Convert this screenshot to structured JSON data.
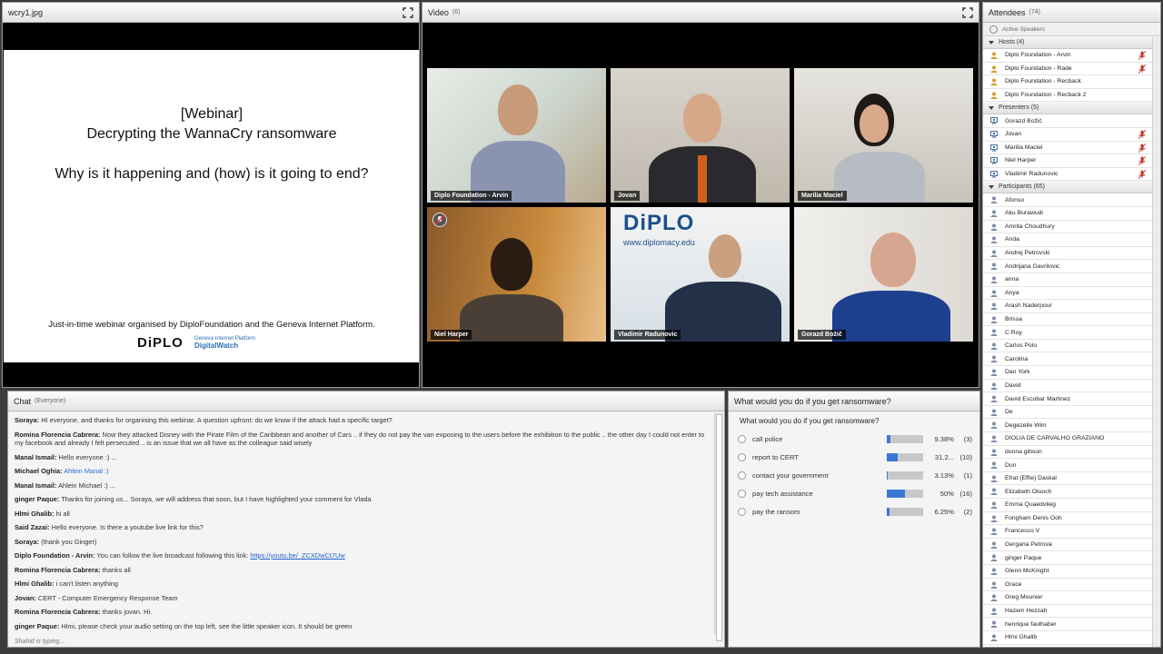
{
  "share": {
    "title": "wcry1.jpg",
    "slide": {
      "line1": "[Webinar]",
      "line2": "Decrypting the WannaCry ransomware",
      "line3": "Why is it happening and (how) is it going to end?",
      "footer": "Just-in-time webinar organised by DiploFoundation and the Geneva Internet Platform.",
      "logo": "DiPLO",
      "dw1": "Geneva Internet Platform",
      "dw2": "DigitalWatch"
    }
  },
  "video": {
    "title": "Video",
    "count": "(6)",
    "tiles": [
      {
        "name": "Diplo Foundation - Arvin"
      },
      {
        "name": "Jovan"
      },
      {
        "name": "Marilia Maciel"
      },
      {
        "name": "Niel Harper"
      },
      {
        "name": "Vladimir Radunovic",
        "banner": "DiPLO",
        "url": "www.diplomacy.edu"
      },
      {
        "name": "Gorazd Božič"
      }
    ]
  },
  "chat": {
    "title": "Chat",
    "scope": "(Everyone)",
    "messages": [
      {
        "sender": "Soraya:",
        "text": "HI everyone, and thanks for organising this webinar. A question upfront: do we know if the attack had a specific target?"
      },
      {
        "sender": "Romina Florencia Cabrera:",
        "text": "Now they attacked Disney with the Pirate Film of the Caribbean and another of Cars .. if they do not pay the van exposing to the users before the exhibition to the public .. the other day I could not enter to my facebook and already I felt persecuted .. is an issue that we all have as the colleague said wisely"
      },
      {
        "sender": "Manal Ismail:",
        "text": "Hello everyone :) ..."
      },
      {
        "sender": "Michael Oghia:",
        "text": "Ahlein Manal :)"
      },
      {
        "sender": "Manal Ismail:",
        "text": "Ahlein Michael :) ..."
      },
      {
        "sender": "ginger Paque:",
        "text": "Thanks for joining us... Soraya, we will address that soon, but I have highlighted your comment for Vlada"
      },
      {
        "sender": "Hlmi Ghalib:",
        "text": "hi all"
      },
      {
        "sender": "Said Zazai:",
        "text": "Hello everyone. Is there a youtube live link for this?"
      },
      {
        "sender": "Soraya:",
        "text": "(thank you Ginger)"
      },
      {
        "sender": "Diplo Foundation - Arvin:",
        "text": "You can follow the live broadcast following this link:",
        "link": "https://youtu.be/_ZCXDwCt7Uw"
      },
      {
        "sender": "Romina Florencia Cabrera:",
        "text": "thanks all"
      },
      {
        "sender": "Hlmi Ghalib:",
        "text": "i can't listen anything"
      },
      {
        "sender": "Jovan:",
        "text": "CERT - Computer Emergency Response Team"
      },
      {
        "sender": "Romina Florencia Cabrera:",
        "text": "thanks jovan. Hi."
      },
      {
        "sender": "ginger Paque:",
        "text": "Hlmi, please check your audio setting on the top left, see the little speaker icon. It should be green"
      }
    ],
    "typing": "Shahid is typing..."
  },
  "poll": {
    "title": "What would you do if you get ransomware?",
    "question": "What would you do if you get ransomware?",
    "options": [
      {
        "label": "call police",
        "pct": "9.38%",
        "count": "(3)",
        "fraction": 0.0938
      },
      {
        "label": "report to CERT",
        "pct": "31.2...",
        "count": "(10)",
        "fraction": 0.312
      },
      {
        "label": "contact your government",
        "pct": "3.13%",
        "count": "(1)",
        "fraction": 0.0313
      },
      {
        "label": "pay tech assistance",
        "pct": "50%",
        "count": "(16)",
        "fraction": 0.5
      },
      {
        "label": "pay the ransom",
        "pct": "6.25%",
        "count": "(2)",
        "fraction": 0.0625
      }
    ]
  },
  "attendees": {
    "title": "Attendees",
    "count": "(74)",
    "active_speakers": "Active Speakers",
    "groups": [
      {
        "label": "Hosts (4)",
        "role": "host",
        "members": [
          {
            "name": "Diplo Foundation - Arvin",
            "mic": true
          },
          {
            "name": "Diplo Foundation - Rade",
            "mic": true
          },
          {
            "name": "Diplo Foundation - Recback",
            "mic": false
          },
          {
            "name": "Diplo Foundation - Recback 2",
            "mic": false
          }
        ]
      },
      {
        "label": "Presenters (5)",
        "role": "presenter",
        "members": [
          {
            "name": "Gorazd Božič",
            "mic": false
          },
          {
            "name": "Jovan",
            "mic": true
          },
          {
            "name": "Marilia Maciel",
            "mic": true
          },
          {
            "name": "Niel Harper",
            "mic": true
          },
          {
            "name": "Vladimir Radunovic",
            "mic": true
          }
        ]
      },
      {
        "label": "Participants (65)",
        "role": "participant",
        "members": [
          {
            "name": "Afonso"
          },
          {
            "name": "Aku Burawudi"
          },
          {
            "name": "Amrita Choudhury"
          },
          {
            "name": "Anda"
          },
          {
            "name": "Andrej Petrovski"
          },
          {
            "name": "Andrijana Gavrilovic"
          },
          {
            "name": "anna"
          },
          {
            "name": "Anya"
          },
          {
            "name": "Arash Naderpour"
          },
          {
            "name": "Brissa"
          },
          {
            "name": "C Roy"
          },
          {
            "name": "Carlos Polo"
          },
          {
            "name": "Carolina"
          },
          {
            "name": "Dan York"
          },
          {
            "name": "David"
          },
          {
            "name": "David Escobar Martinez"
          },
          {
            "name": "De"
          },
          {
            "name": "Degezelle Wim"
          },
          {
            "name": "DIOLIA DE CARVALHO GRAZIANO"
          },
          {
            "name": "donna gibson"
          },
          {
            "name": "Dun"
          },
          {
            "name": "Efrat (Effie) Daskal"
          },
          {
            "name": "Elizabeth Oluoch"
          },
          {
            "name": "Emma Quaedvlieg"
          },
          {
            "name": "Fongham Denis Ooh"
          },
          {
            "name": "Francesco V"
          },
          {
            "name": "Gergana Petrova"
          },
          {
            "name": "ginger Paque"
          },
          {
            "name": "Glenn McKnight"
          },
          {
            "name": "Grace"
          },
          {
            "name": "Greg Mounier"
          },
          {
            "name": "Hazem Hezzah"
          },
          {
            "name": "henrique faulhaber"
          },
          {
            "name": "Hlmi Ghalib"
          }
        ]
      }
    ]
  },
  "colors": {
    "accent": "#3a78d6",
    "link": "#1f5fc8",
    "mic": "#c0392b"
  }
}
